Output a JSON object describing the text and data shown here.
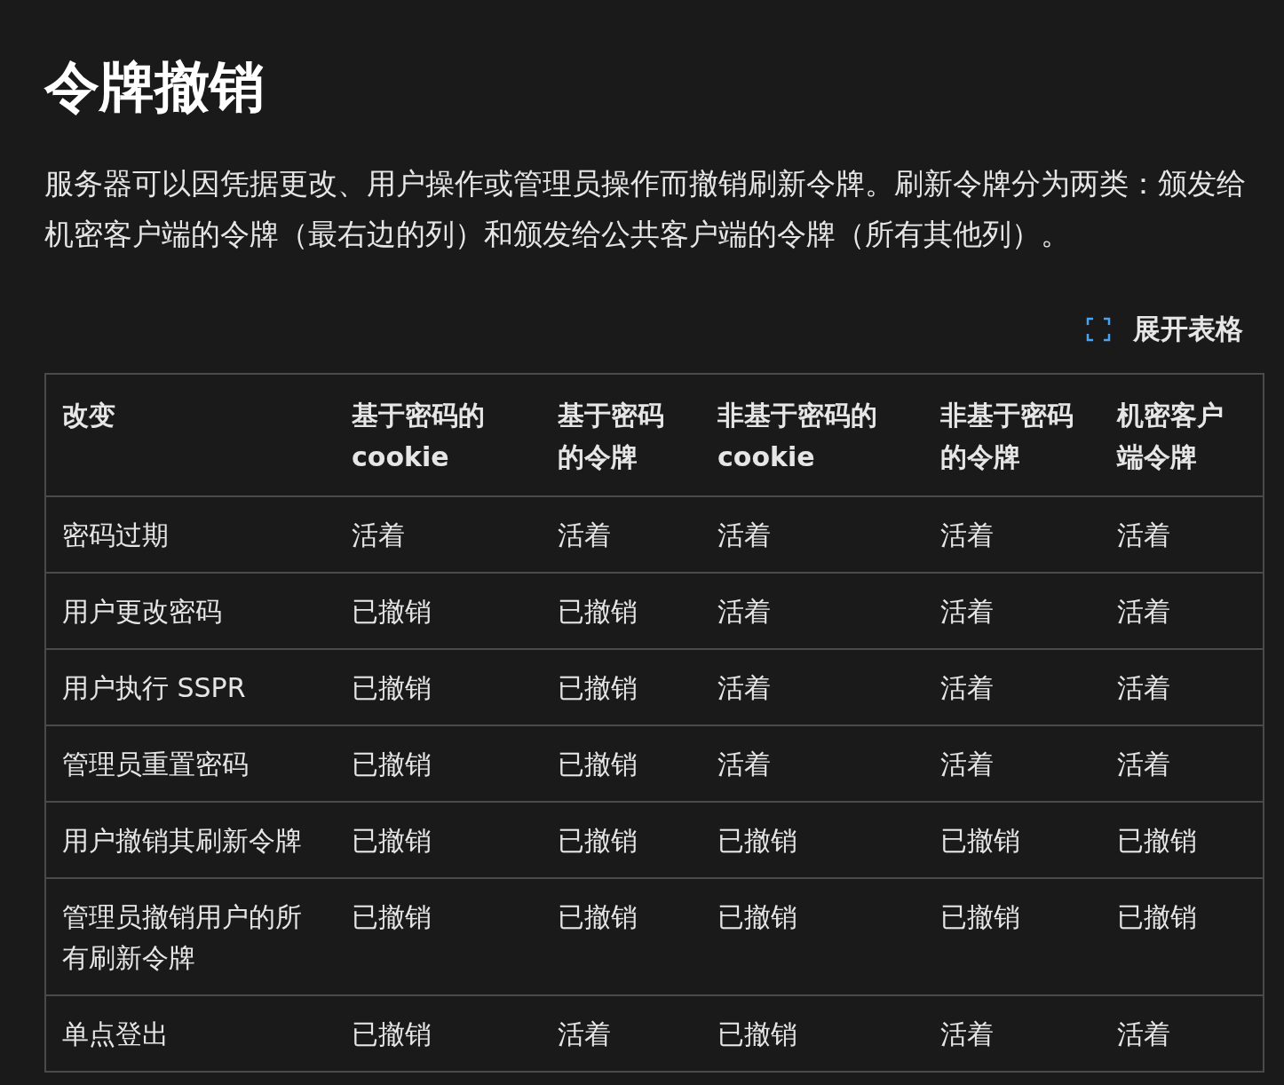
{
  "title": "令牌撤销",
  "description": "服务器可以因凭据更改、用户操作或管理员操作而撤销刷新令牌。刷新令牌分为两类：颁发给机密客户端的令牌（最右边的列）和颁发给公共客户端的令牌（所有其他列）。",
  "expand_table": {
    "label": "展开表格"
  },
  "table": {
    "columns": [
      "改变",
      "基于密码的 cookie",
      "基于密码的令牌",
      "非基于密码的 cookie",
      "非基于密码的令牌",
      "机密客户端令牌"
    ],
    "rows": [
      [
        "密码过期",
        "活着",
        "活着",
        "活着",
        "活着",
        "活着"
      ],
      [
        "用户更改密码",
        "已撤销",
        "已撤销",
        "活着",
        "活着",
        "活着"
      ],
      [
        "用户执行 SSPR",
        "已撤销",
        "已撤销",
        "活着",
        "活着",
        "活着"
      ],
      [
        "管理员重置密码",
        "已撤销",
        "已撤销",
        "活着",
        "活着",
        "活着"
      ],
      [
        "用户撤销其刷新令牌",
        "已撤销",
        "已撤销",
        "已撤销",
        "已撤销",
        "已撤销"
      ],
      [
        "管理员撤销用户的所有刷新令牌",
        "已撤销",
        "已撤销",
        "已撤销",
        "已撤销",
        "已撤销"
      ],
      [
        "单点登出",
        "已撤销",
        "活着",
        "已撤销",
        "活着",
        "活着"
      ]
    ]
  }
}
